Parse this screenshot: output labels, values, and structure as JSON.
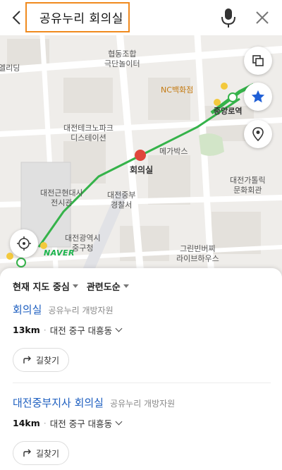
{
  "search": {
    "query": "공유누리 회의실"
  },
  "map": {
    "labels": {
      "eliding": "엘리딩",
      "hyeopdong": "협동조합\n극단놀이터",
      "nc": "NC백화점",
      "jungang": "중앙로역",
      "teckno": "대전테크노파크\n디스테이션",
      "megabox": "메가박스",
      "meeting": "회의실",
      "geundae": "대전근현대사\n전시관",
      "jungbu_police": "대전중부\n경찰서",
      "catholic": "대전가톨릭\n문화회관",
      "junggu_office": "대전광역시\n중구청",
      "greenbean": "그린빈버찌\n라이브하우스",
      "naver": "NAVER"
    }
  },
  "filters": [
    "현재 지도 중심",
    "관련도순"
  ],
  "results": [
    {
      "title": "회의실",
      "category": "공유누리 개방자원",
      "distance": "13km",
      "address": "대전 중구 대흥동",
      "directions": "길찾기"
    },
    {
      "title": "대전중부지사 회의실",
      "category": "공유누리 개방자원",
      "distance": "14km",
      "address": "대전 중구 대흥동",
      "directions": "길찾기"
    }
  ],
  "colors": {
    "accent": "#1e5fc0",
    "highlight": "#f08a1e",
    "route": "#35b34a",
    "star": "#1f5fd6"
  }
}
